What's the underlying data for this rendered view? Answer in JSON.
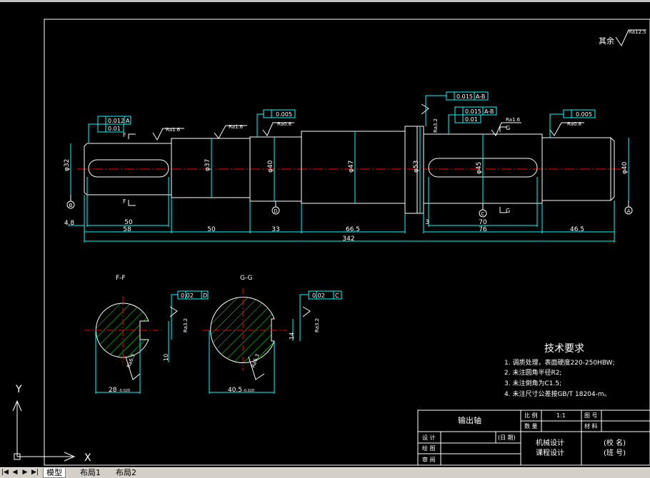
{
  "drawing": {
    "surface_finish_other": {
      "label": "其余",
      "roughness": "Ra12.5"
    },
    "roughness_labels": {
      "left_journal": "Ra1.6",
      "mid_journal": "Ra1.6",
      "center": "Ra0.8",
      "right_upper": "Ra1.6",
      "right_end": "Ra0.8",
      "key1": "Ra3.2",
      "section_f": "Ra3.2",
      "section_f_bottom": "Ra6.3",
      "section_g": "Ra3.2",
      "section_g_bottom": "Ra6.3",
      "shoulder": "Ra3.2"
    },
    "tolerance_frames": {
      "left_a": "0.012",
      "left_a_ref": "A",
      "left_b": "0.01",
      "mid": "0.005",
      "shoulder": "0.015",
      "shoulder_ref": "A-B",
      "right_a": "0.015",
      "right_a_ref": "A-B",
      "right_b": "0.01",
      "right_end": "0.005",
      "section_f": "0.02",
      "section_f_ref": "D",
      "section_g": "0.02",
      "section_g_ref": "C"
    },
    "datums": {
      "b": "B",
      "d": "D",
      "c": "C",
      "a": "A"
    },
    "section_marks": {
      "f": "F",
      "g": "G"
    },
    "diameters": {
      "d1": "φ32",
      "d2": "φ37",
      "d3": "φ40",
      "d4": "φ47",
      "d5": "φ53",
      "d6": "φ45",
      "d7": "φ40"
    },
    "dims_horizontal": {
      "chamfer_left": "4.8",
      "key_left": "50",
      "seg1": "58",
      "seg2": "50",
      "seg3": "33",
      "seg4": "66.5",
      "collar": "3",
      "key_right": "70",
      "seg5": "76",
      "seg6": "46.5",
      "total": "342"
    },
    "sections": {
      "f_title": "F-F",
      "g_title": "G-G",
      "f_width": "28",
      "f_width_tol": "-0.020",
      "f_key_depth": "10",
      "g_width": "40.5",
      "g_width_tol": "-0.020",
      "g_key_depth": "14"
    },
    "tech_requirements": {
      "title": "技术要求",
      "items": [
        "1. 调质处理，表面硬度220-250HBW;",
        "2. 未注圆角半径R2;",
        "3. 未注倒角为C1.5;",
        "4. 未注尺寸公差按GB/T 18204-m。"
      ]
    },
    "title_block": {
      "part_name": "输出轴",
      "ratio_label": "比 例",
      "ratio_value": "1:1",
      "drawing_no_label": "图 号",
      "quantity_label": "数 量",
      "material_label": "材 料",
      "designer_label": "设 计",
      "date_label": "(日 期)",
      "drafter_label": "绘 图",
      "reviewer_label": "审 阅",
      "course_line1": "机械设计",
      "course_line2": "课程设计",
      "school": "(校 名)",
      "class": "(班 号)"
    },
    "ucs": {
      "x": "X",
      "y": "Y"
    }
  },
  "status_bar": {
    "tabs": [
      "模型",
      "布局1",
      "布局2"
    ]
  },
  "colors": {
    "background": "#000000",
    "geometry": "#ffffff",
    "centerline": "#ff0000",
    "dimension": "#00ffff",
    "hatch": "#00ff00"
  }
}
